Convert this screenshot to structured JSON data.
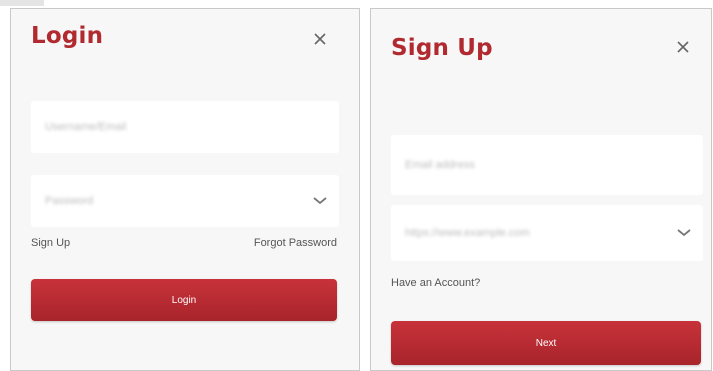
{
  "colors": {
    "accent": "#b02a30",
    "panel_bg": "#f7f7f7",
    "field_bg": "#ffffff"
  },
  "login": {
    "title": "Login",
    "close_icon": "close-icon",
    "username_placeholder": "Username/Email",
    "password_placeholder": "Password",
    "chevron_icon": "chevron-down-icon",
    "sign_up_link": "Sign Up",
    "forgot_password_link": "Forgot Password",
    "login_button": "Login"
  },
  "signup": {
    "title": "Sign Up",
    "close_icon": "close-icon",
    "email_placeholder": "Email address",
    "url_placeholder": "https://www.example.com",
    "chevron_icon": "chevron-down-icon",
    "have_account_link": "Have an Account?",
    "next_button": "Next"
  }
}
